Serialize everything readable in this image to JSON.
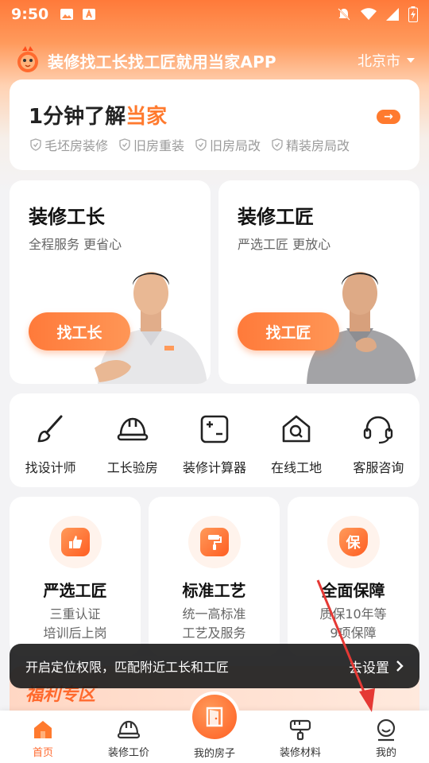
{
  "status_bar": {
    "time": "9:50"
  },
  "header": {
    "title": "装修找工长找工匠就用当家APP",
    "city": "北京市"
  },
  "intro": {
    "title_prefix": "1分钟了解",
    "title_accent": "当家",
    "arrow": "→",
    "tags": [
      "毛坯房装修",
      "旧房重装",
      "旧房局改",
      "精装房局改"
    ]
  },
  "roles": [
    {
      "title": "装修工长",
      "subtitle": "全程服务 更省心",
      "button": "找工长"
    },
    {
      "title": "装修工匠",
      "subtitle": "严选工匠 更放心",
      "button": "找工匠"
    }
  ],
  "services": [
    {
      "label": "找设计师",
      "icon": "brush-icon"
    },
    {
      "label": "工长验房",
      "icon": "helmet-icon"
    },
    {
      "label": "装修计算器",
      "icon": "calculator-icon"
    },
    {
      "label": "在线工地",
      "icon": "house-search-icon"
    },
    {
      "label": "客服咨询",
      "icon": "headset-icon"
    }
  ],
  "features": [
    {
      "title": "严选工匠",
      "line1": "三重认证",
      "line2": "培训后上岗",
      "icon": "thumbs-up-icon"
    },
    {
      "title": "标准工艺",
      "line1": "统一高标准",
      "line2": "工艺及服务",
      "icon": "paint-roller-icon"
    },
    {
      "title": "全面保障",
      "line1": "质保10年等",
      "line2": "9项保障",
      "icon": "shield-icon",
      "badge": "保"
    }
  ],
  "welfare": {
    "title": "福利专区"
  },
  "toast": {
    "message": "开启定位权限，匹配附近工长和工匠",
    "action": "去设置"
  },
  "tabbar": {
    "items": [
      {
        "label": "首页",
        "icon": "home-icon"
      },
      {
        "label": "装修工价",
        "icon": "helmet-icon"
      },
      {
        "label": "我的房子",
        "icon": "door-icon"
      },
      {
        "label": "装修材料",
        "icon": "paint-roller-icon"
      },
      {
        "label": "我的",
        "icon": "user-icon"
      }
    ]
  },
  "colors": {
    "accent": "#ff7a2e",
    "toast_bg": "#1e1e1e",
    "arrow": "#e53935"
  }
}
